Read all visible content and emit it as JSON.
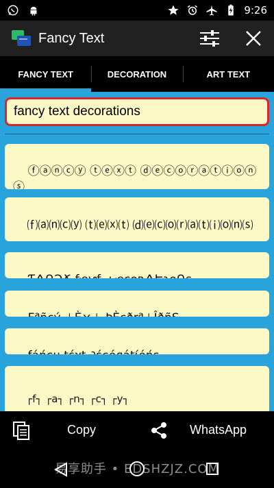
{
  "status_bar": {
    "time": "9:26",
    "left_icons": [
      "whatsapp-icon",
      "android-icon"
    ],
    "right_icons": [
      "star-icon",
      "alarm-icon",
      "airplane-icon",
      "battery-charging-icon"
    ]
  },
  "action_bar": {
    "title": "Fancy Text"
  },
  "tabs": [
    {
      "label": "FANCY TEXT",
      "active": true
    },
    {
      "label": "DECORATION",
      "active": false
    },
    {
      "label": "ART TEXT",
      "active": false
    }
  ],
  "input": {
    "value": "fancy text decorations"
  },
  "results": [
    "ⓕⓐⓝⓒⓨ ⓣⓔⓧⓣ ⓓⓔⓒⓞⓡⓐⓣⓘⓞⓝⓢ",
    "⒡⒜⒩⒞⒴ ⒯⒠⒳⒯ ⒟⒠⒞⒪⒭⒜⒯⒤⒪⒩⒮",
    "ƬѦՌϽՃ ƭҽƴƭ ԃҽϲօʀѦԵɿօՌs",
    "Fªñçý ⊥È×⊥ ÞÈçðrª⊥ÎðñS",
    "ƒáήςч ţέχţ ∂έςóяáţίóήş",
    "┌f┐ ┌a┐ ┌n┐ ┌c┐ ┌y┐\n┌t┐ ┌e┐ ┌x┐ ┌t┐\n┌d┐ ┌e┐ ┌c┐ ┌o┐ ┌r┐ ┌a┐ ┌t┐"
  ],
  "bottom_bar": {
    "copy_label": "Copy",
    "whatsapp_label": "WhatsApp"
  },
  "watermark": "易享助手 • EDSHZJZ.COM",
  "colors": {
    "accent": "#29a3dc",
    "card_bg": "#fdf9c7",
    "input_border": "#d8262c",
    "action_bar": "#212121"
  }
}
